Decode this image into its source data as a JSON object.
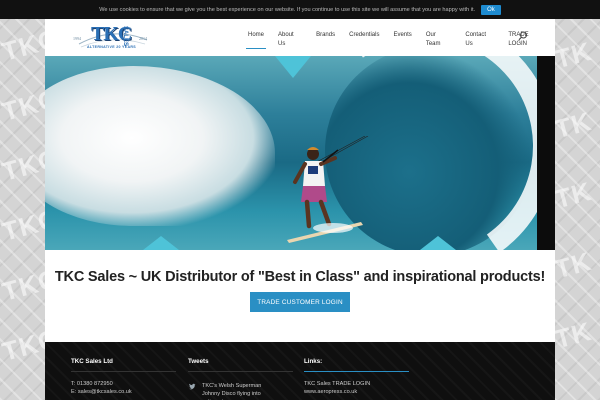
{
  "cookie": {
    "message": "We use cookies to ensure that we give you the best experience on our website. If you continue to use this site we will assume that you are happy with it.",
    "ok_label": "Ok"
  },
  "logo": {
    "brand": "TKC",
    "sub": "SALES",
    "year_start": "1994",
    "year_end": "2014",
    "tagline": "ALTERNATIVE 20 YEARS"
  },
  "nav": {
    "items": [
      {
        "label": "Home",
        "active": true
      },
      {
        "label": "About Us"
      },
      {
        "label": "Brands"
      },
      {
        "label": "Credentials"
      },
      {
        "label": "Events"
      },
      {
        "label": "Our Team"
      },
      {
        "label": "Contact Us"
      },
      {
        "label": "TRADE LOGIN"
      }
    ]
  },
  "main": {
    "tagline": "TKC Sales ~ UK Distributor of \"Best in Class\" and inspirational products!",
    "login_button": "TRADE CUSTOMER LOGIN"
  },
  "footer": {
    "col1": {
      "title": "TKC Sales Ltd",
      "line1": "T:  01380 872950",
      "line2": "E:  sales@tkcsales.co.uk"
    },
    "col2": {
      "title": "Tweets",
      "tweet": "TKC's Welsh Superman Johnny Disco flying into action at"
    },
    "col3": {
      "title": "Links:",
      "link1": "TKC Sales TRADE LOGIN",
      "link2": "www.aeropress.co.uk"
    }
  },
  "colors": {
    "accent": "#2a8fc4",
    "cookie_bar": "#111111",
    "footer": "#0f0f0f"
  }
}
